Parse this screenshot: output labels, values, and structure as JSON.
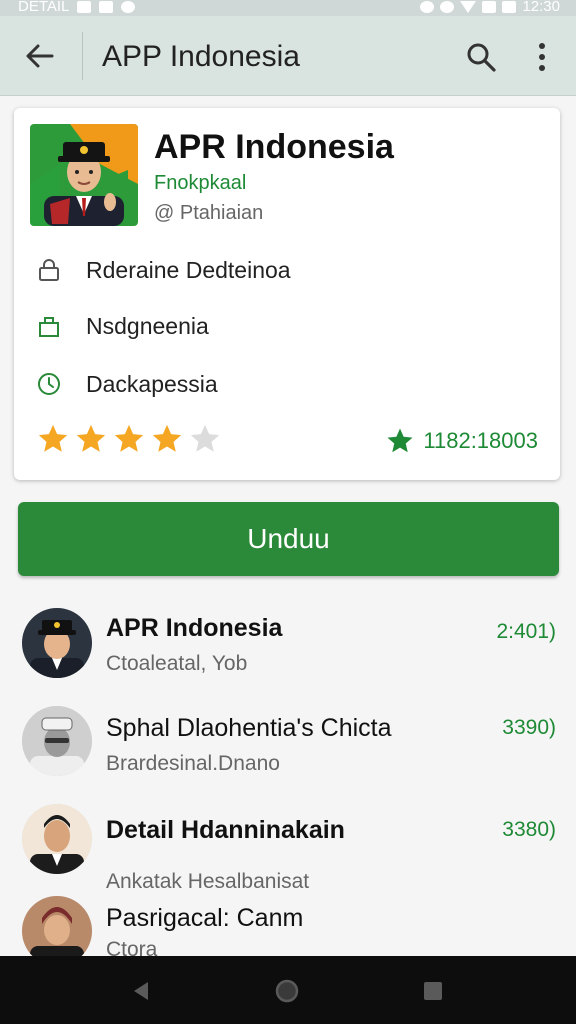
{
  "status_bar": {
    "left_label": "DETAIL",
    "time": "12:30"
  },
  "app_bar": {
    "title": "APP Indonesia"
  },
  "app": {
    "name": "APR Indonesia",
    "developer": "Fnokpkaal",
    "category": "@ Ptahiaian",
    "info": [
      {
        "icon": "lock-icon",
        "text": "Rderaine Dedteinoa"
      },
      {
        "icon": "bag-icon",
        "text": "Nsdgneenia"
      },
      {
        "icon": "clock-icon",
        "text": "Dackapessia"
      }
    ],
    "rating_stars": 4,
    "rating_max": 5,
    "downloads": "1182:18003"
  },
  "install_button": {
    "label": "Unduu"
  },
  "list": [
    {
      "title": "APR Indonesia",
      "subtitle": "Ctoaleatal, Yob",
      "count": "2:401)"
    },
    {
      "title": "Sphal Dlaohentia's Chicta",
      "subtitle": "Brardesinal.Dnano",
      "count": "3390)"
    },
    {
      "title": "Detail Hdanninakain",
      "subtitle": "Ankatak Hesalbanisat",
      "count": "3380)"
    },
    {
      "title": "Pasrigacal: Canm",
      "subtitle": "Ctora",
      "count": ""
    }
  ],
  "colors": {
    "accent_green": "#2a8a3a",
    "star_yellow": "#f5a623",
    "app_bar": "#d9e3e0"
  }
}
